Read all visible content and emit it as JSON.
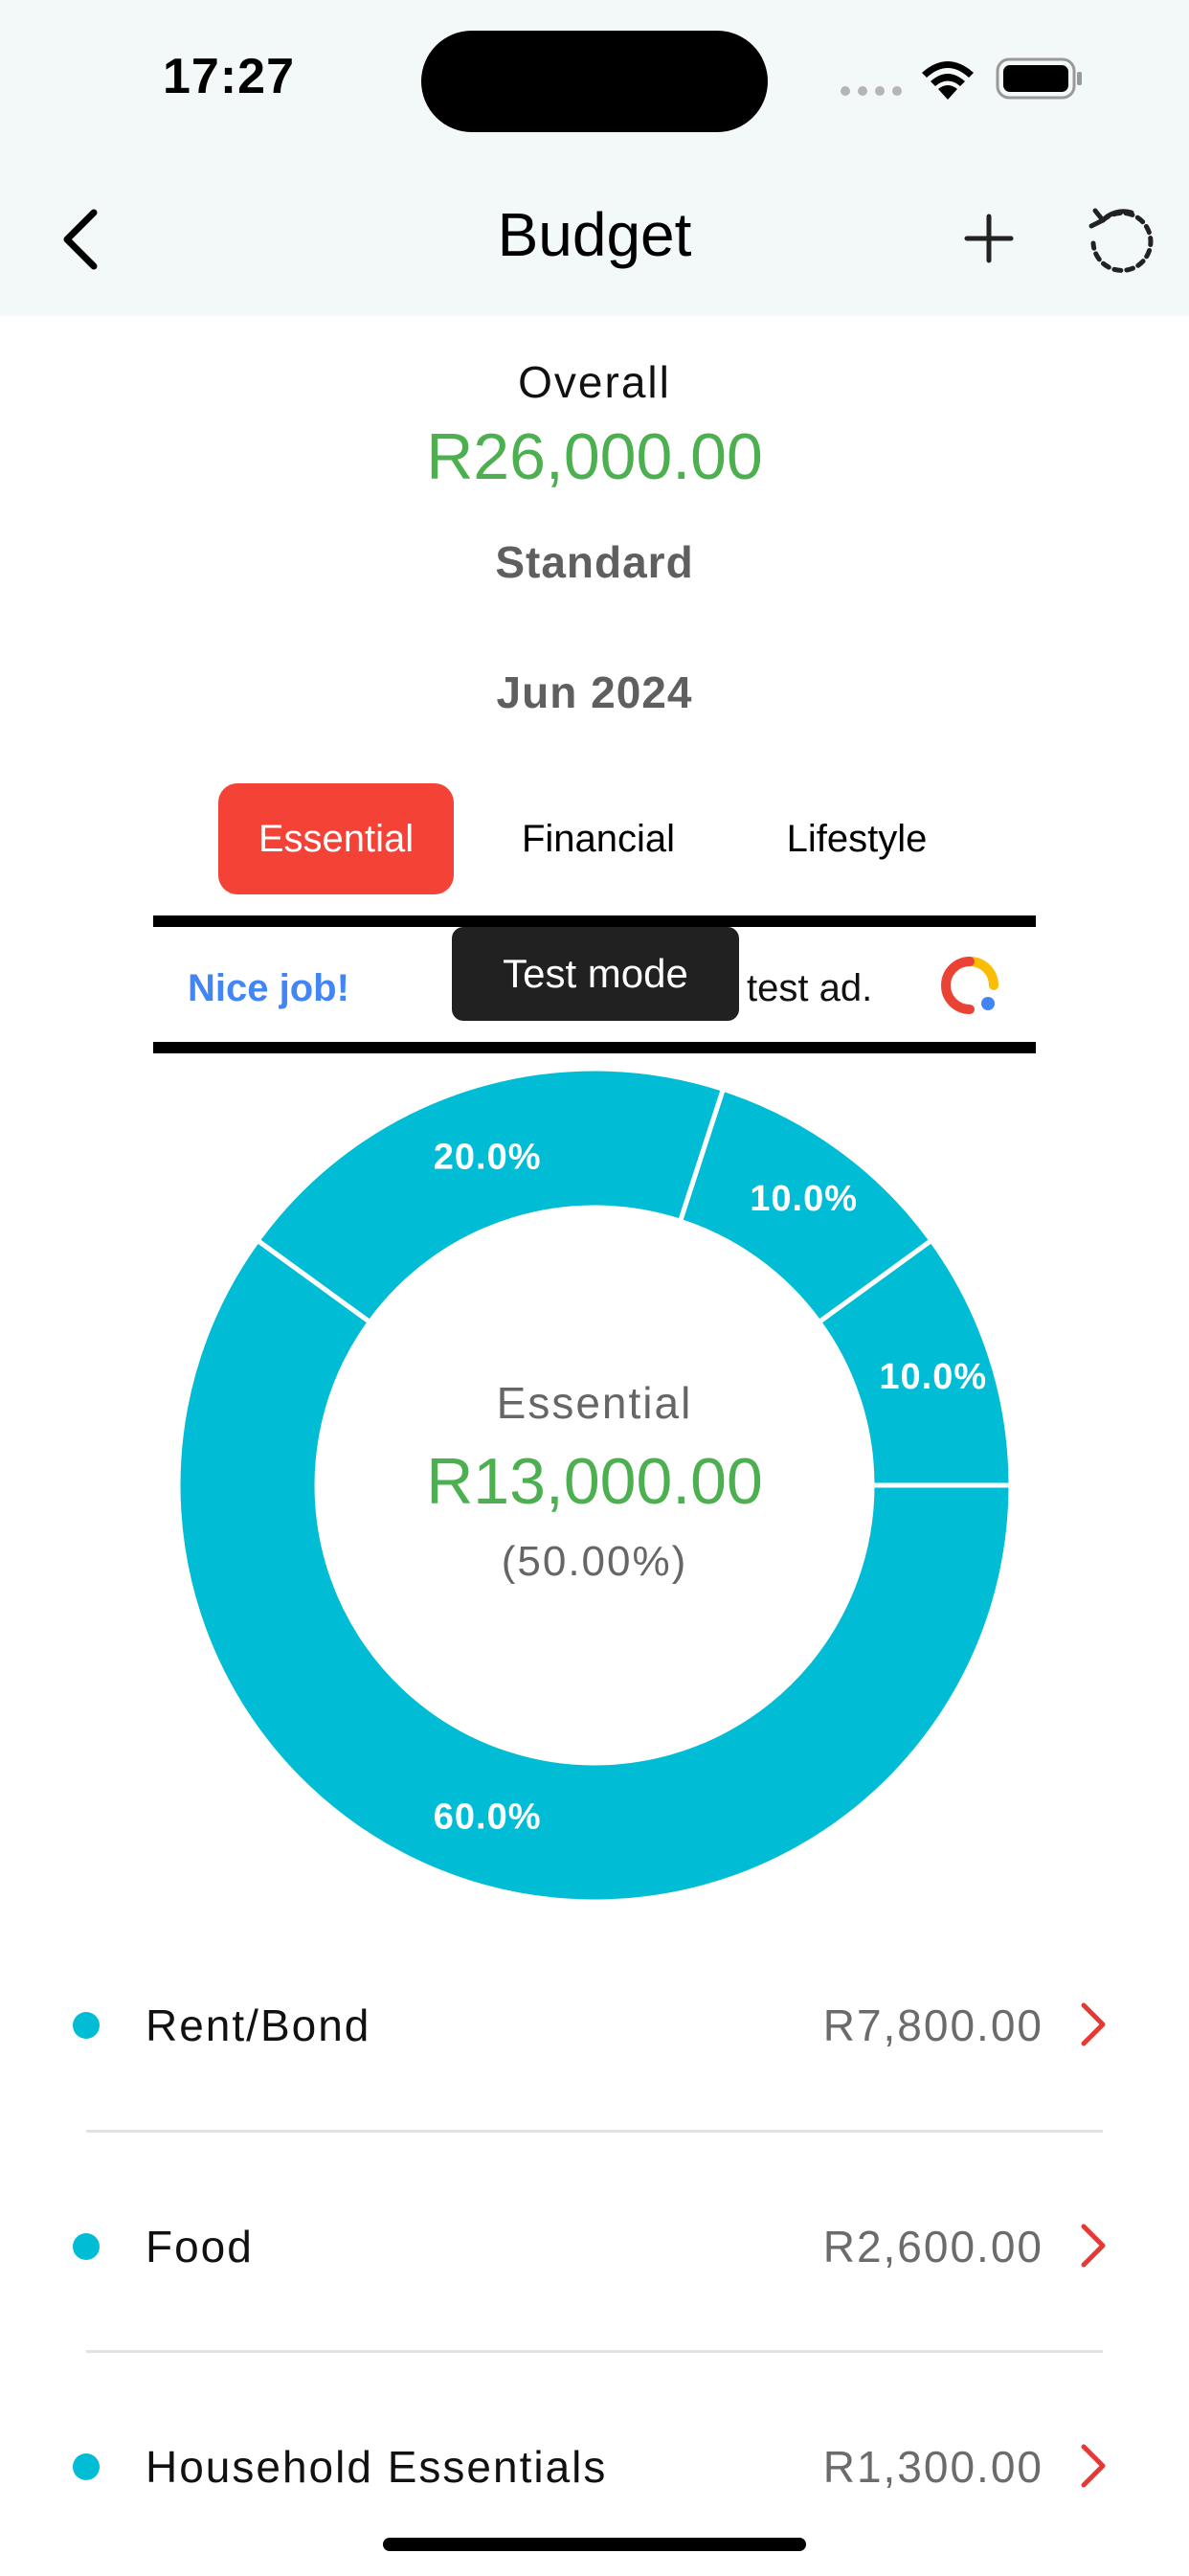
{
  "status_bar": {
    "time": "17:27"
  },
  "nav": {
    "title": "Budget"
  },
  "summary": {
    "overall_label": "Overall",
    "overall_value": "R26,000.00",
    "plan": "Standard",
    "month": "Jun 2024"
  },
  "tabs": [
    {
      "label": "Essential",
      "selected": true
    },
    {
      "label": "Financial",
      "selected": false
    },
    {
      "label": "Lifestyle",
      "selected": false
    }
  ],
  "ad": {
    "left_text": "Nice job!",
    "right_text": "test ad.",
    "tooltip": "Test mode"
  },
  "chart_data": {
    "type": "pie",
    "donut": true,
    "color": "#00bcd4",
    "slices": [
      {
        "label": "60.0%",
        "value": 60.0
      },
      {
        "label": "20.0%",
        "value": 20.0
      },
      {
        "label": "10.0%",
        "value": 10.0
      },
      {
        "label": "10.0%",
        "value": 10.0
      }
    ],
    "center": {
      "label": "Essential",
      "value": "R13,000.00",
      "percent": "(50.00%)"
    }
  },
  "items": [
    {
      "name": "Rent/Bond",
      "amount": "R7,800.00"
    },
    {
      "name": "Food",
      "amount": "R2,600.00"
    },
    {
      "name": "Household Essentials",
      "amount": "R1,300.00"
    }
  ],
  "colors": {
    "accent_green": "#4caf50",
    "tab_active": "#f44336",
    "chart": "#00bcd4",
    "chevron": "#e53935"
  }
}
